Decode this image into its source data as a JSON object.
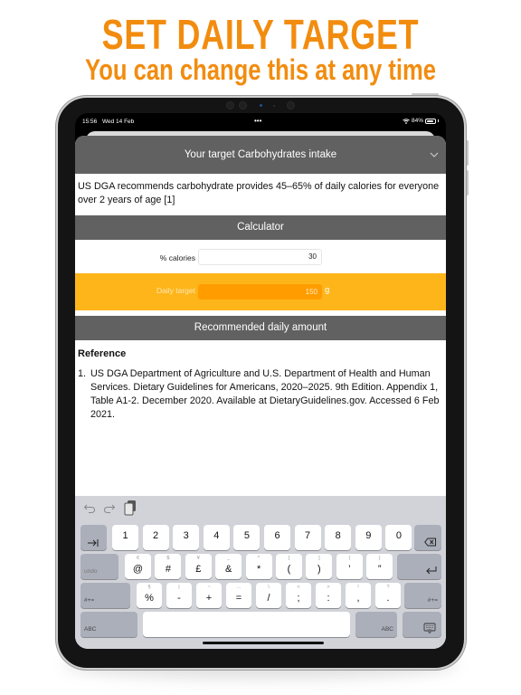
{
  "promo": {
    "title": "SET DAILY TARGET",
    "subtitle": "You can change this at any time",
    "color": "#F28C0F"
  },
  "status_bar": {
    "time": "15:56",
    "date": "Wed 14 Feb",
    "dots": "•••",
    "battery": "84%",
    "battery_level": 0.84,
    "wifi_icon": "wifi-icon"
  },
  "sheet": {
    "title": "Your target Carbohydrates intake",
    "collapse_icon": "chevron-down-icon",
    "description": "US DGA recommends carbohydrate provides 45–65% of daily calories for everyone over 2 years of age [1]"
  },
  "calculator": {
    "header": "Calculator",
    "calories_label": "% calories",
    "calories_value": "30",
    "target_label": "Daily target",
    "target_value": "150",
    "target_unit": "g",
    "accent_color": "#FDB51A",
    "field_color": "#FF9D00"
  },
  "recommended": {
    "header": "Recommended daily amount"
  },
  "reference": {
    "title": "Reference",
    "items": [
      {
        "number": "1.",
        "text": "US DGA Department of Agriculture and U.S. Department of Health and Human Services. Dietary Guidelines for Americans, 2020–2025. 9th Edition. Appendix 1, Table A1-2. December 2020. Available at DietaryGuidelines.gov. Accessed 6 Feb 2021."
      }
    ]
  },
  "keyboard": {
    "toolbar": [
      "undo-icon",
      "redo-icon",
      "paste-icon"
    ],
    "row1": {
      "left": "tab-icon",
      "keys": [
        "1",
        "2",
        "3",
        "4",
        "5",
        "6",
        "7",
        "8",
        "9",
        "0"
      ],
      "right": "delete-icon"
    },
    "row2": {
      "left": "undo",
      "keys": [
        {
          "main": "@",
          "alt": "€"
        },
        {
          "main": "#",
          "alt": "$"
        },
        {
          "main": "£",
          "alt": "¥"
        },
        {
          "main": "&",
          "alt": "_"
        },
        {
          "main": "*",
          "alt": "^"
        },
        {
          "main": "(",
          "alt": "["
        },
        {
          "main": ")",
          "alt": "]"
        },
        {
          "main": "’",
          "alt": "{"
        },
        {
          "main": "”",
          "alt": "}"
        }
      ],
      "right": "return-icon"
    },
    "row3": {
      "left": "#+=",
      "keys": [
        {
          "main": "%",
          "alt": "§"
        },
        {
          "main": "-",
          "alt": "|"
        },
        {
          "main": "+",
          "alt": "~"
        },
        {
          "main": "=",
          "alt": "…"
        },
        {
          "main": "/",
          "alt": "\\"
        },
        {
          "main": ";",
          "alt": "<"
        },
        {
          "main": ":",
          "alt": ">"
        },
        {
          "main": ",",
          "alt": "!"
        },
        {
          "main": ".",
          "alt": "?"
        }
      ],
      "right": "#+="
    },
    "row4": {
      "left": "ABC",
      "right": "ABC",
      "dismiss": "keyboard-dismiss-icon"
    }
  }
}
